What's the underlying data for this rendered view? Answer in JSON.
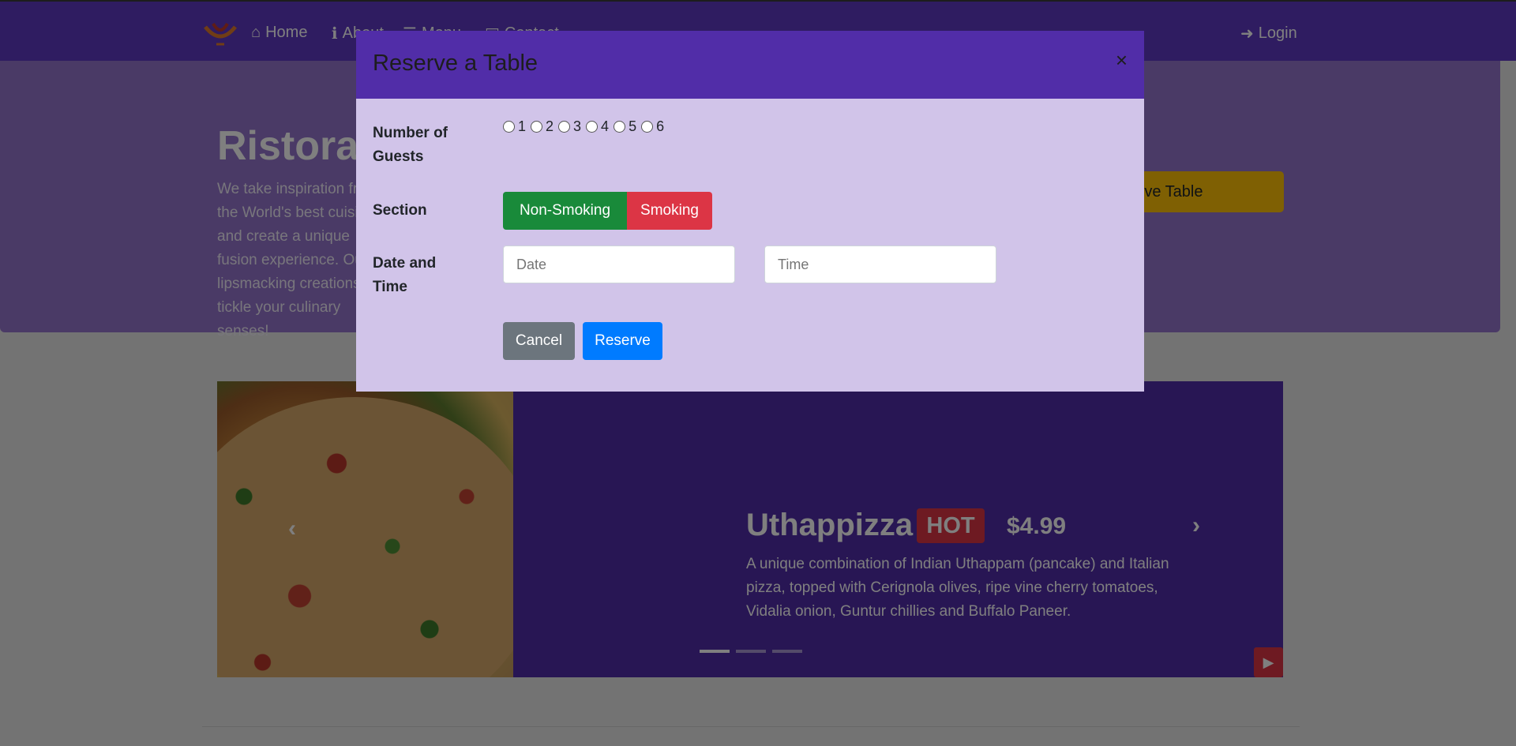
{
  "navbar": {
    "home_label": "Home",
    "about_label": "About",
    "menu_label": "Menu",
    "contact_label": "Contact",
    "login_label": "Login"
  },
  "jumbotron": {
    "title": "Ristorante con Fusion",
    "text": "We take inspiration from the World's best cuisines, and create a unique fusion experience. Our lipsmacking creations will tickle your culinary senses!",
    "reserve_label": "Reserve Table"
  },
  "featured": {
    "name": "Uthappizza",
    "badge": "HOT",
    "price": "$4.99",
    "description": "A unique combination of Indian Uthappam (pancake) and Italian pizza, topped with Cerignola olives, ripe vine cherry tomatoes, Vidalia onion, Guntur chillies and Buffalo Paneer."
  },
  "modal": {
    "title": "Reserve a Table",
    "close": "×",
    "guests_label_line1": "Number of",
    "guests_label_line2": "Guests",
    "guest_options": [
      "1",
      "2",
      "3",
      "4",
      "5",
      "6"
    ],
    "section_label": "Section",
    "section_options": [
      "Non-Smoking",
      "Smoking"
    ],
    "datetime_label_line1": "Date and",
    "datetime_label_line2": "Time",
    "date_placeholder": "Date",
    "time_placeholder": "Time",
    "cancel_label": "Cancel",
    "reserve_label": "Reserve"
  },
  "colors": {
    "navbar": "#5f38c2",
    "jumbotron": "#9575cd",
    "modal_header": "#512da8",
    "modal_body": "#d1c4e9",
    "non_smoking": "#198a3a",
    "smoking": "#dc3545",
    "cancel": "#6c757d",
    "reserve": "#007bff"
  }
}
